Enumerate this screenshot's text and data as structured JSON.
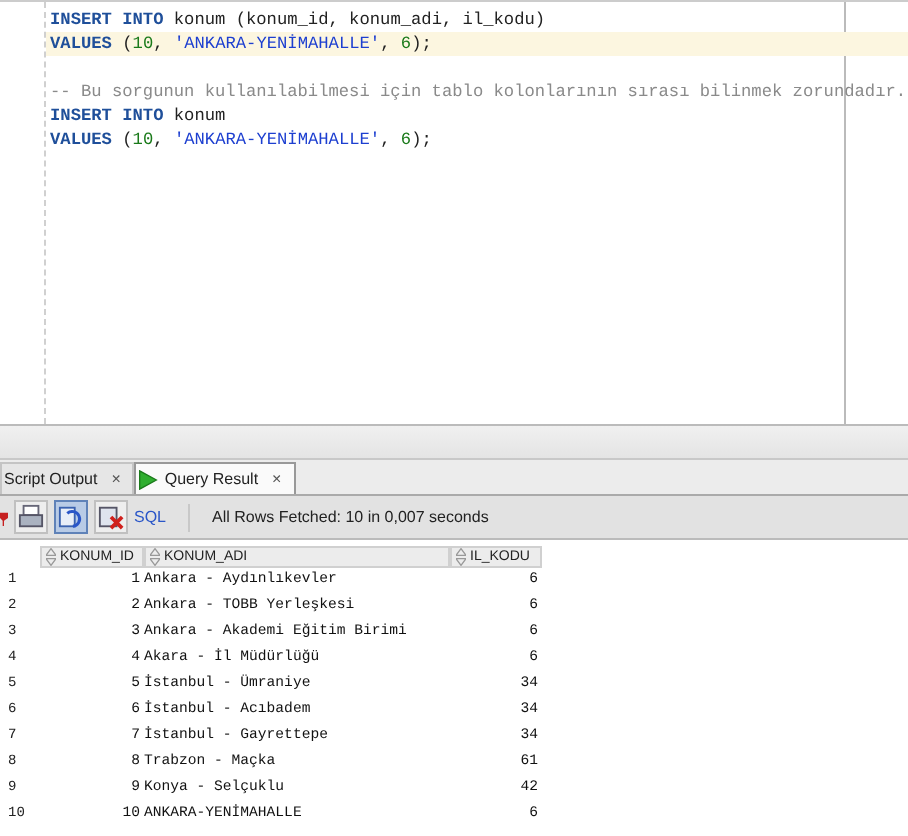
{
  "editor": {
    "blocks": [
      [
        {
          "current": false,
          "tokens": [
            {
              "text": "INSERT INTO",
              "kind": "keyword"
            },
            {
              "text": " konum (konum_id, konum_adi, il_kodu)",
              "kind": "plain"
            }
          ]
        },
        {
          "current": true,
          "tokens": [
            {
              "text": "VALUES",
              "kind": "keyword"
            },
            {
              "text": " (",
              "kind": "plain"
            },
            {
              "text": "10",
              "kind": "number"
            },
            {
              "text": ", ",
              "kind": "plain"
            },
            {
              "text": "'ANKARA-YENİMAHALLE'",
              "kind": "string"
            },
            {
              "text": ", ",
              "kind": "plain"
            },
            {
              "text": "6",
              "kind": "number"
            },
            {
              "text": ");",
              "kind": "plain"
            }
          ]
        }
      ],
      [
        {
          "current": false,
          "tokens": [
            {
              "text": "-- Bu sorgunun kullanılabilmesi için tablo kolonlarının sırası bilinmek zorundadır.",
              "kind": "comment"
            }
          ]
        },
        {
          "current": false,
          "tokens": [
            {
              "text": "INSERT INTO",
              "kind": "keyword"
            },
            {
              "text": " konum",
              "kind": "plain"
            }
          ]
        },
        {
          "current": false,
          "tokens": [
            {
              "text": "VALUES",
              "kind": "keyword"
            },
            {
              "text": " (",
              "kind": "plain"
            },
            {
              "text": "10",
              "kind": "number"
            },
            {
              "text": ", ",
              "kind": "plain"
            },
            {
              "text": "'ANKARA-YENİMAHALLE'",
              "kind": "string"
            },
            {
              "text": ", ",
              "kind": "plain"
            },
            {
              "text": "6",
              "kind": "number"
            },
            {
              "text": ");",
              "kind": "plain"
            }
          ]
        }
      ]
    ]
  },
  "tabs": [
    {
      "label": "Script Output",
      "close": "×",
      "selected": false,
      "kind": "plain"
    },
    {
      "label": "Query Result",
      "close": "×",
      "selected": true,
      "kind": "run"
    }
  ],
  "toolbar": {
    "buttons": [
      {
        "kind": "pin"
      },
      {
        "kind": "print",
        "pressed": false
      },
      {
        "kind": "refresh",
        "pressed": true
      },
      {
        "kind": "delete",
        "pressed": false
      }
    ],
    "sql_link": "SQL",
    "status": "All Rows Fetched: 10 in 0,007 seconds"
  },
  "table": {
    "columns": [
      "KONUM_ID",
      "KONUM_ADI",
      "IL_KODU"
    ],
    "rows": [
      {
        "num": "1",
        "cells": [
          "1",
          "Ankara - Aydınlıkevler",
          "6"
        ]
      },
      {
        "num": "2",
        "cells": [
          "2",
          "Ankara - TOBB Yerleşkesi",
          "6"
        ]
      },
      {
        "num": "3",
        "cells": [
          "3",
          "Ankara - Akademi Eğitim Birimi",
          "6"
        ]
      },
      {
        "num": "4",
        "cells": [
          "4",
          "Akara - İl Müdürlüğü",
          "6"
        ]
      },
      {
        "num": "5",
        "cells": [
          "5",
          "İstanbul - Ümraniye",
          "34"
        ]
      },
      {
        "num": "6",
        "cells": [
          "6",
          "İstanbul - Acıbadem",
          "34"
        ]
      },
      {
        "num": "7",
        "cells": [
          "7",
          "İstanbul - Gayrettepe",
          "34"
        ]
      },
      {
        "num": "8",
        "cells": [
          "8",
          "Trabzon - Maçka",
          "61"
        ]
      },
      {
        "num": "9",
        "cells": [
          "9",
          "Konya - Selçuklu",
          "42"
        ]
      },
      {
        "num": "10",
        "cells": [
          "10",
          "ANKARA-YENİMAHALLE",
          "6"
        ]
      }
    ]
  }
}
